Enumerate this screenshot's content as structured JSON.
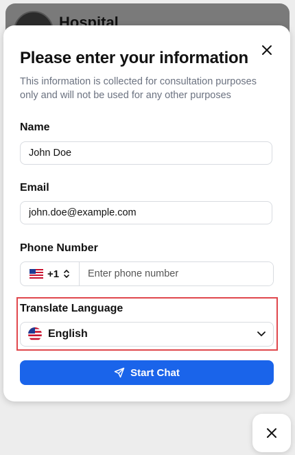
{
  "backdrop": {
    "title": "Hospital"
  },
  "modal": {
    "title": "Please enter your information",
    "subtitle": "This information is collected for consultation purposes only and will not be used for any other purposes",
    "name": {
      "label": "Name",
      "value": "John Doe"
    },
    "email": {
      "label": "Email",
      "value": "john.doe@example.com"
    },
    "phone": {
      "label": "Phone Number",
      "dial_code": "+1",
      "placeholder": "Enter phone number",
      "flag": "us-flag-icon"
    },
    "language": {
      "label": "Translate Language",
      "value": "English",
      "flag": "us-flag-round-icon"
    },
    "start_button": {
      "label": "Start Chat",
      "icon": "send-icon"
    }
  },
  "colors": {
    "primary": "#1a64ea",
    "highlight": "#e0474c",
    "muted_text": "#6b7280",
    "border": "#d8dbe0"
  }
}
